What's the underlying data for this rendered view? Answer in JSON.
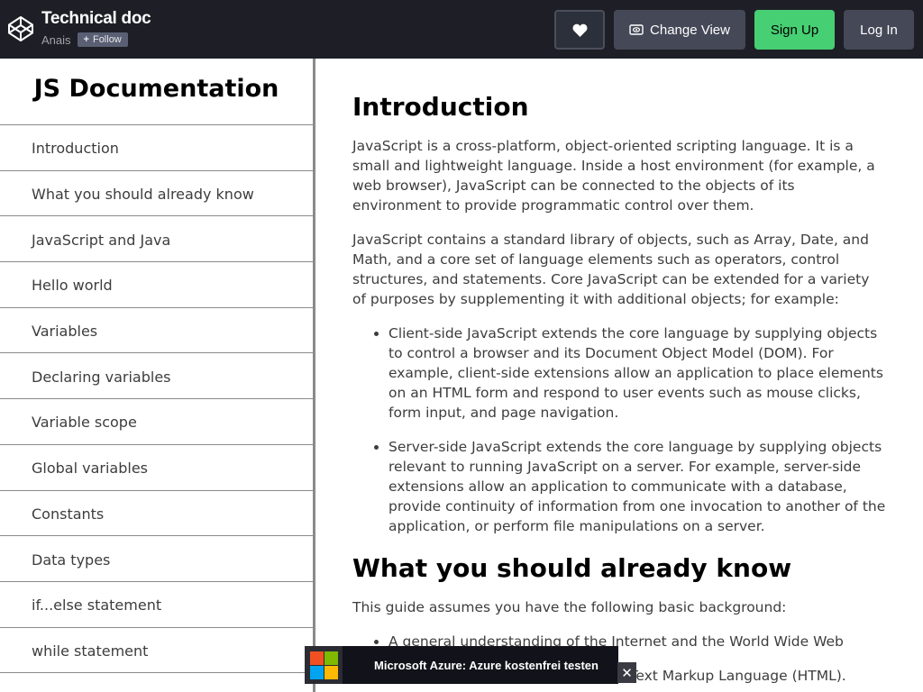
{
  "header": {
    "pen_title": "Technical doc",
    "owner": "Anais",
    "follow_label": "Follow",
    "change_view_label": "Change View",
    "signup_label": "Sign Up",
    "login_label": "Log In",
    "icons": {
      "logo": "codepen-logo-icon",
      "heart": "heart-icon",
      "change_view": "eye-icon",
      "follow": "plus-icon"
    },
    "colors": {
      "bar_bg": "#1e1f26",
      "signup_bg": "#47cf73",
      "button_bg": "#444857"
    }
  },
  "sidebar": {
    "title": "JS Documentation",
    "items": [
      {
        "label": "Introduction"
      },
      {
        "label": "What you should already know"
      },
      {
        "label": "JavaScript and Java"
      },
      {
        "label": "Hello world"
      },
      {
        "label": "Variables"
      },
      {
        "label": "Declaring variables"
      },
      {
        "label": "Variable scope"
      },
      {
        "label": "Global variables"
      },
      {
        "label": "Constants"
      },
      {
        "label": "Data types"
      },
      {
        "label": "if...else statement"
      },
      {
        "label": "while statement"
      }
    ]
  },
  "main": {
    "sections": [
      {
        "title": "Introduction",
        "paragraphs": [
          "JavaScript is a cross-platform, object-oriented scripting language. It is a small and lightweight language. Inside a host environment (for example, a web browser), JavaScript can be connected to the objects of its environment to provide programmatic control over them.",
          "JavaScript contains a standard library of objects, such as Array, Date, and Math, and a core set of language elements such as operators, control structures, and statements. Core JavaScript can be extended for a variety of purposes by supplementing it with additional objects; for example:"
        ],
        "bullets": [
          "Client-side JavaScript extends the core language by supplying objects to control a browser and its Document Object Model (DOM). For example, client-side extensions allow an application to place elements on an HTML form and respond to user events such as mouse clicks, form input, and page navigation.",
          "Server-side JavaScript extends the core language by supplying objects relevant to running JavaScript on a server. For example, server-side extensions allow an application to communicate with a database, provide continuity of information from one invocation to another of the application, or perform file manipulations on a server."
        ]
      },
      {
        "title": "What you should already know",
        "paragraphs": [
          "This guide assumes you have the following basic background:"
        ],
        "bullets": [
          "A general understanding of the Internet and the World Wide Web",
          "Good working knowledge of HyperText Markup Language (HTML)."
        ]
      }
    ]
  },
  "ad": {
    "text": "Microsoft Azure: Azure kostenfrei testen",
    "close_label": "✕",
    "logo_icon": "microsoft-logo-icon",
    "logo_colors": [
      "#f25022",
      "#7fba00",
      "#00a4ef",
      "#ffb900"
    ]
  }
}
